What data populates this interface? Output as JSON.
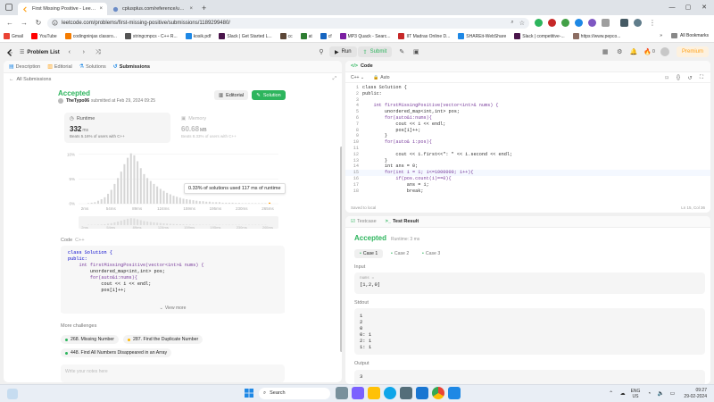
{
  "browser": {
    "tabs": [
      {
        "title": "First Missing Positive - LeetCode",
        "active": true
      },
      {
        "title": "cplusplus.com/reference/unorde",
        "active": false
      }
    ],
    "url": "leetcode.com/problems/first-missing-positive/submissions/1189299480/",
    "bookmarks": [
      {
        "label": "Gmail",
        "color": "#ea4335"
      },
      {
        "label": "YouTube",
        "color": "#ff0000"
      },
      {
        "label": "codingninjas classro...",
        "color": "#f57c00"
      },
      {
        "label": "stringcmpcs - C++ R...",
        "color": "#555555"
      },
      {
        "label": "kosik.pdf",
        "color": "#1e88e5"
      },
      {
        "label": "Slack | Get Started L...",
        "color": "#4a154b"
      },
      {
        "label": "cc",
        "color": "#5b4636"
      },
      {
        "label": "at",
        "color": "#2e7d32"
      },
      {
        "label": "cf",
        "color": "#1565c0"
      },
      {
        "label": "MP3 Quack - Searc...",
        "color": "#7b1fa2"
      },
      {
        "label": "IIT Madras Online D...",
        "color": "#c62828"
      },
      {
        "label": "SHAREit-WebShare",
        "color": "#1e88e5"
      },
      {
        "label": "Slack | competitive-...",
        "color": "#4a154b"
      },
      {
        "label": "https://www.pepco...",
        "color": "#8d6e63"
      }
    ],
    "all_bookmarks": "All Bookmarks"
  },
  "header": {
    "problem_list": "Problem List",
    "run": "Run",
    "submit": "Submit",
    "fire_count": "0",
    "premium": "Premium"
  },
  "left": {
    "tabs": [
      "Description",
      "Editorial",
      "Solutions",
      "Submissions"
    ],
    "back": "All Submissions",
    "status": "Accepted",
    "author": "TheTypo06",
    "submitted": "submitted at Feb 29, 2024 09:25",
    "editorial_btn": "Editorial",
    "solution_btn": "Solution",
    "runtime": {
      "label": "Runtime",
      "value": "332",
      "unit": "ms",
      "beats": "Beats 5.16% of users with C++"
    },
    "memory": {
      "label": "Memory",
      "value": "60.68",
      "unit": "MB",
      "beats": "Beats 8.33% of users with C++"
    },
    "tooltip": "0.33% of solutions used 117 ms of runtime",
    "code_label": "Code",
    "code_lang": "C++",
    "code_lines": [
      "class Solution {",
      "public:",
      "",
      "    int firstMissingPositive(vector<int>& nums) {",
      "        unordered_map<int,int> pos;",
      "        for(auto&i:nums){",
      "            cout << i << endl;",
      "            pos[i]++;"
    ],
    "view_more": "View more",
    "more_challenges": "More challenges",
    "challenges": [
      {
        "label": "268. Missing Number",
        "color": "#2db55d"
      },
      {
        "label": "287. Find the Duplicate Number",
        "color": "#ffb800"
      },
      {
        "label": "448. Find All Numbers Disappeared in an Array",
        "color": "#2db55d"
      }
    ],
    "notes_placeholder": "Write your notes here"
  },
  "chart_data": {
    "type": "bar",
    "title": "",
    "ylabel": "",
    "xlabel": "",
    "yticks": [
      "10%",
      "5%",
      "0%"
    ],
    "xticks": [
      "2ms",
      "54ms",
      "89ms",
      "124ms",
      "159ms",
      "195ms",
      "230ms",
      "265ms"
    ],
    "values": [
      0.1,
      0.2,
      0.3,
      0.6,
      0.9,
      1.3,
      2.0,
      2.8,
      4.0,
      5.2,
      6.5,
      8.0,
      9.3,
      10.2,
      9.8,
      8.6,
      7.2,
      6.0,
      5.2,
      4.6,
      4.0,
      3.5,
      3.0,
      2.6,
      2.2,
      1.9,
      1.6,
      1.4,
      1.2,
      1.0,
      0.9,
      0.8,
      0.7,
      0.6,
      0.5,
      0.5,
      0.4,
      0.4,
      0.3,
      0.3,
      0.3,
      0.2,
      0.2,
      0.2,
      0.2,
      0.15,
      0.15,
      0.1,
      0.1,
      0.1,
      0.1,
      0.1,
      0.08,
      0.08,
      0.05
    ],
    "ylim": [
      0,
      10.5
    ]
  },
  "editor": {
    "tab": "Code",
    "lang": "C++",
    "mode": "Auto",
    "lines": [
      "class Solution {",
      "public:",
      "",
      "    int firstMissingPositive(vector<int>& nums) {",
      "        unordered_map<int,int> pos;",
      "        for(auto&i:nums){",
      "            cout << i << endl;",
      "            pos[i]++;",
      "        }",
      "        for(auto& i:pos){",
      "",
      "            cout << i.first<<\": \" << i.second << endl;",
      "        }",
      "        int ans = 0;",
      "        for(int i = 1; i<=1000000; i++){",
      "            if(pos.count(i)==0){",
      "                ans = i;",
      "                break;"
    ],
    "saved": "Saved to local",
    "cursor": "Ln 15, Col 36"
  },
  "test": {
    "tabs": [
      "Testcase",
      "Test Result"
    ],
    "status": "Accepted",
    "runtime": "Runtime: 3 ms",
    "cases": [
      "Case 1",
      "Case 2",
      "Case 3"
    ],
    "input_label": "Input",
    "input_var": "nums =",
    "input_value": "[1,2,0]",
    "stdout_label": "Stdout",
    "stdout": [
      "1",
      "2",
      "0",
      "0: 1",
      "2: 1",
      "1: 1"
    ],
    "output_label": "Output",
    "output": "3"
  },
  "taskbar": {
    "search": "Search",
    "lang1": "ENG",
    "lang2": "US",
    "time": "09:27",
    "date": "29-02-2024"
  }
}
